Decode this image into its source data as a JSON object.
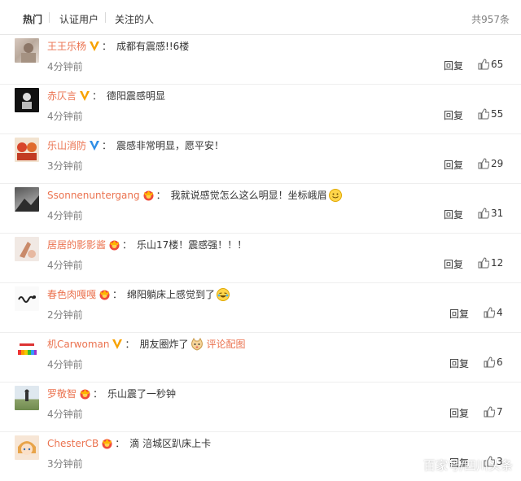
{
  "tabs": {
    "hot": "热门",
    "verified": "认证用户",
    "following": "关注的人",
    "total": "共957条"
  },
  "comments": [
    {
      "user": "王王乐杨",
      "badge": "orange-v",
      "text": "成都有震感!!6楼",
      "emoji": "",
      "link": "",
      "time": "4分钟前",
      "reply": "回复",
      "likes": "65"
    },
    {
      "user": "赤仄言",
      "badge": "orange-v",
      "text": "德阳震感明显",
      "emoji": "",
      "link": "",
      "time": "4分钟前",
      "reply": "回复",
      "likes": "55"
    },
    {
      "user": "乐山消防",
      "badge": "blue-v",
      "text": "震感非常明显，愿平安！",
      "emoji": "",
      "link": "",
      "time": "3分钟前",
      "reply": "回复",
      "likes": "29"
    },
    {
      "user": "Ssonnenuntergang",
      "badge": "member-crown",
      "text": "我就说感觉怎么这么明显！坐标峨眉",
      "emoji": "smile-emoji",
      "link": "",
      "time": "4分钟前",
      "reply": "回复",
      "likes": "31"
    },
    {
      "user": "居居的影影酱",
      "badge": "member-crown",
      "text": "乐山17楼！震感强！！！",
      "emoji": "",
      "link": "",
      "time": "4分钟前",
      "reply": "回复",
      "likes": "12"
    },
    {
      "user": "春色肉嘎嘎",
      "badge": "member-crown",
      "text": "绵阳躺床上感觉到了",
      "emoji": "laugh-cry-emoji",
      "link": "",
      "time": "2分钟前",
      "reply": "回复",
      "likes": "4"
    },
    {
      "user": "机Carwoman",
      "badge": "orange-v",
      "text": "朋友圈炸了",
      "emoji": "cat-emoji",
      "link": "评论配图",
      "time": "4分钟前",
      "reply": "回复",
      "likes": "6"
    },
    {
      "user": "罗敬智",
      "badge": "member-crown",
      "text": "乐山震了一秒钟",
      "emoji": "",
      "link": "",
      "time": "4分钟前",
      "reply": "回复",
      "likes": "7"
    },
    {
      "user": "ChesterCB",
      "badge": "member-crown",
      "text": "滴 涪城区趴床上卡",
      "emoji": "",
      "link": "",
      "time": "3分钟前",
      "reply": "回复",
      "likes": "3"
    }
  ],
  "watermark": "百家号/四川头条",
  "colors": {
    "username": "#eb7350",
    "time": "#808080",
    "orange_v": "#f7a200",
    "blue_v": "#2f8ee6"
  }
}
